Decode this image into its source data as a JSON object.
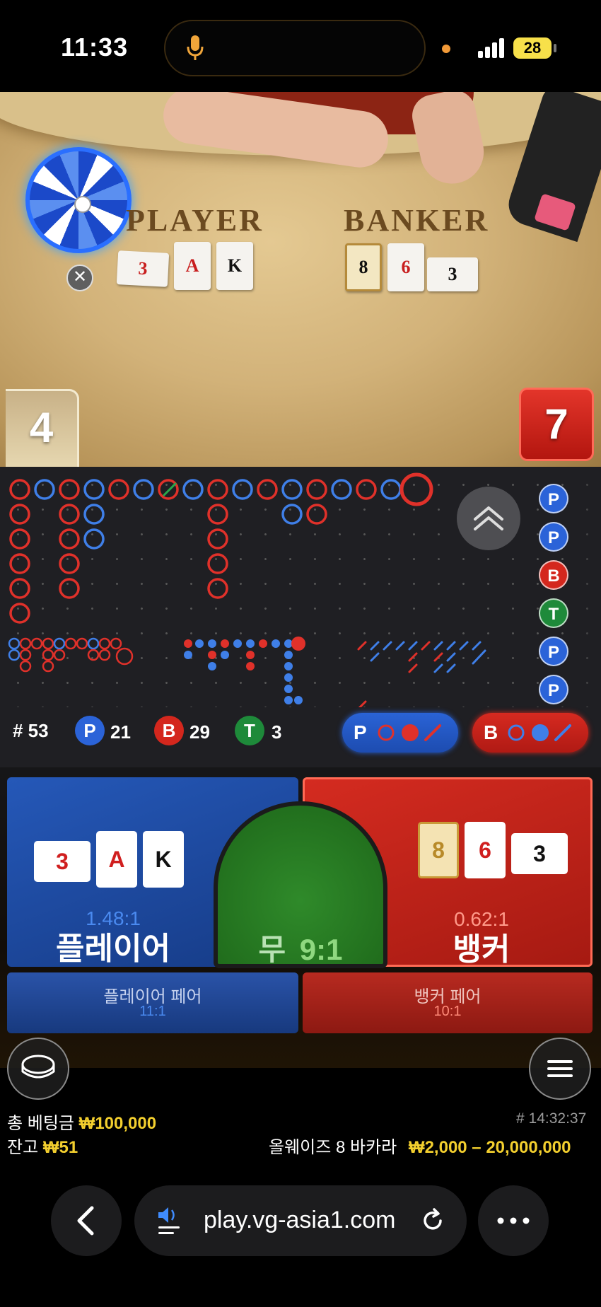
{
  "status_bar": {
    "time": "11:33",
    "battery": "28"
  },
  "table": {
    "player_label": "PLAYER",
    "banker_label": "BANKER",
    "player_cards": [
      "3",
      "A",
      "K"
    ],
    "banker_cards": [
      "8",
      "6",
      "3"
    ],
    "player_score": "4",
    "banker_score": "7",
    "close_glyph": "✕"
  },
  "roadmap": {
    "side_labels": [
      "P",
      "P",
      "B",
      "T",
      "P",
      "P"
    ],
    "stats": {
      "count": "# 53",
      "player_letter": "P",
      "player_count": "21",
      "banker_letter": "B",
      "banker_count": "29",
      "tie_letter": "T",
      "tie_count": "3"
    },
    "predict_player": "P",
    "predict_banker": "B",
    "colors": {
      "player": "#3f7fe8",
      "banker": "#e0312a",
      "tie": "#2aa84a"
    }
  },
  "bet": {
    "player": {
      "odds": "1.48:1",
      "name": "플레이어",
      "cards": [
        "3",
        "A",
        "K"
      ]
    },
    "tie": {
      "name": "무",
      "odds": "9:1"
    },
    "banker": {
      "odds": "0.62:1",
      "name": "뱅커",
      "cards": [
        "8",
        "6",
        "3"
      ]
    },
    "player_pair": {
      "name": "플레이어 페어",
      "odds": "11:1"
    },
    "banker_pair": {
      "name": "뱅커 페어",
      "odds": "10:1"
    }
  },
  "info": {
    "total_bet_label": "총 베팅금",
    "total_bet_value": "₩100,000",
    "balance_label": "잔고",
    "balance_value": "₩51",
    "round_time": "# 14:32:37",
    "table_name": "올웨이즈 8 바카라",
    "limit": "₩2,000 – 20,000,000"
  },
  "browser": {
    "url": "play.vg-asia1.com"
  }
}
